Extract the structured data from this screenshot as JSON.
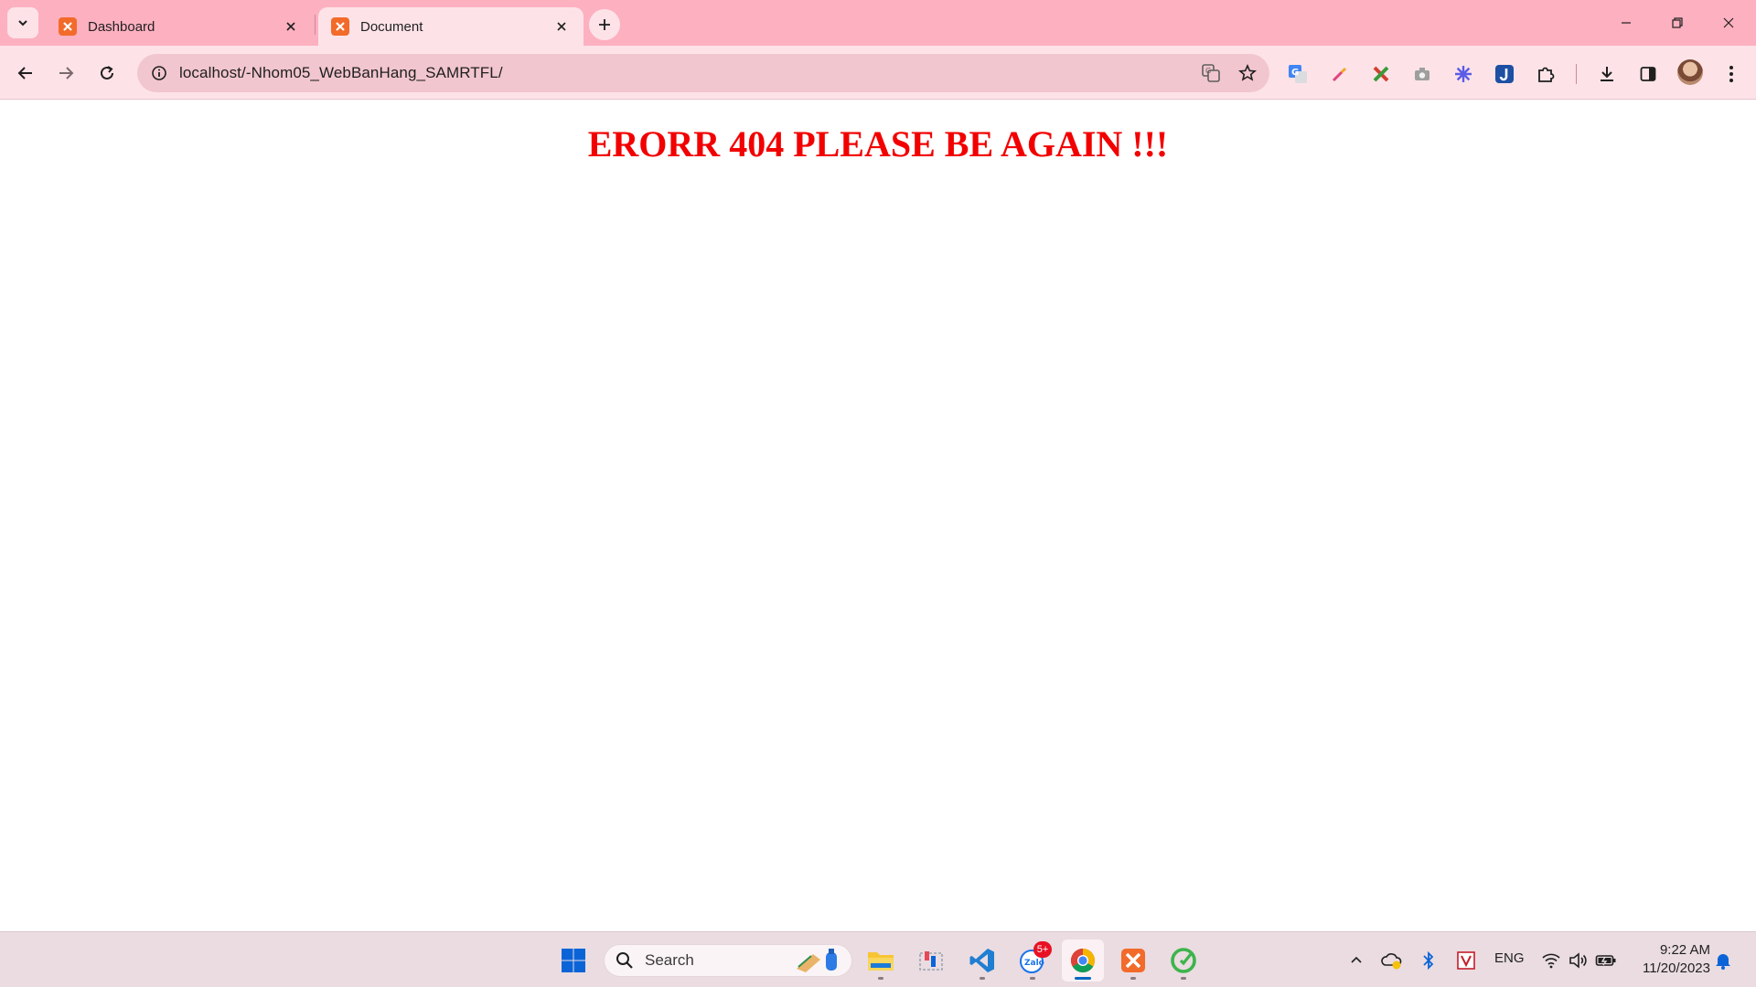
{
  "browser": {
    "tabs": [
      {
        "title": "Dashboard",
        "active": false
      },
      {
        "title": "Document",
        "active": true
      }
    ],
    "address_bar": {
      "url": "localhost/-Nhom05_WebBanHang_SAMRTFL/"
    }
  },
  "page": {
    "heading": "ERORR 404 PLEASE BE AGAIN !!!",
    "heading_color": "#f20000"
  },
  "taskbar": {
    "search_placeholder": "Search",
    "zalo_badge": "5+",
    "language": "ENG",
    "clock_time": "9:22 AM",
    "clock_date": "11/20/2023"
  },
  "colors": {
    "tabstrip": "#fdb0c0",
    "toolbar": "#fde3e8",
    "omnibox": "#f2c6cf",
    "taskbar": "#eadce1"
  }
}
